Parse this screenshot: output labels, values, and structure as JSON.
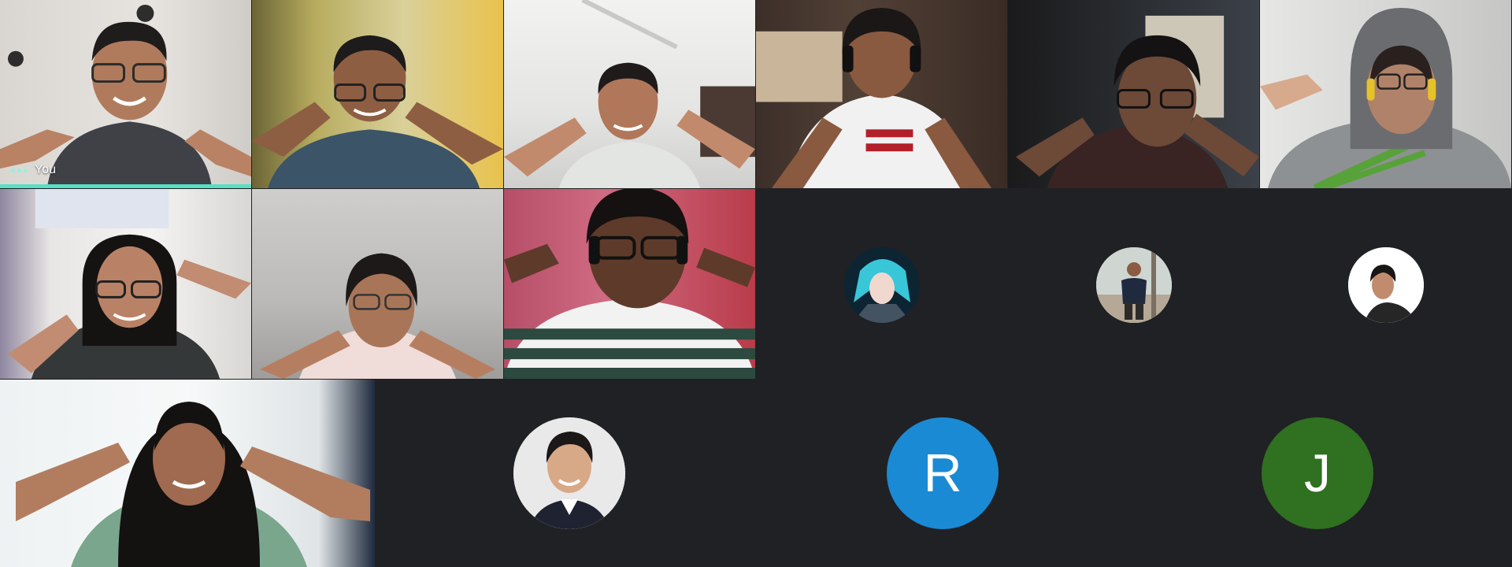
{
  "self_tile": {
    "label": "You",
    "more_options_icon": "three-dots-icon",
    "speaking": true
  },
  "video_participants": 10,
  "avatar_participants": [
    {
      "kind": "photo",
      "description": "anime-character"
    },
    {
      "kind": "photo",
      "description": "person-outdoors"
    },
    {
      "kind": "photo",
      "description": "person-portrait"
    },
    {
      "kind": "photo",
      "description": "formal-portrait"
    },
    {
      "kind": "initial",
      "initial": "R",
      "color": "#1a8ad4"
    },
    {
      "kind": "initial",
      "initial": "J",
      "color": "#2f7021"
    }
  ],
  "colors": {
    "background": "#202124",
    "speaking_indicator": "#59dfc4",
    "label_text": "#ffffff"
  }
}
